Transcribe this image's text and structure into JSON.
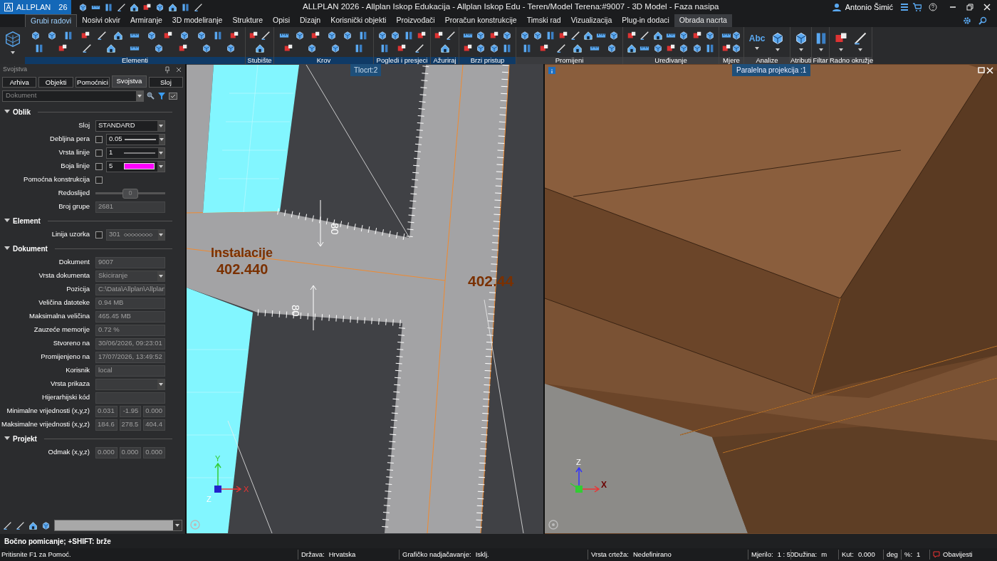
{
  "title_bar": {
    "logo": "ALLPLAN",
    "version": "26",
    "title": "ALLPLAN 2026 - Allplan Iskop Edukacija - Allplan Iskop Edu - Teren/Model Terena:#9007 - 3D Model - Faza nasipa",
    "user": "Antonio Šimić"
  },
  "ribbon": {
    "tabs": [
      {
        "label": "Grubi radovi",
        "selected": true,
        "contextual": false
      },
      {
        "label": "Nosivi okvir",
        "selected": false,
        "contextual": false
      },
      {
        "label": "Armiranje",
        "selected": false,
        "contextual": false
      },
      {
        "label": "3D modeliranje",
        "selected": false,
        "contextual": false
      },
      {
        "label": "Strukture",
        "selected": false,
        "contextual": false
      },
      {
        "label": "Opisi",
        "selected": false,
        "contextual": false
      },
      {
        "label": "Dizajn",
        "selected": false,
        "contextual": false
      },
      {
        "label": "Korisnički objekti",
        "selected": false,
        "contextual": false
      },
      {
        "label": "Proizvođači",
        "selected": false,
        "contextual": false
      },
      {
        "label": "Proračun konstrukcije",
        "selected": false,
        "contextual": false
      },
      {
        "label": "Timski rad",
        "selected": false,
        "contextual": false
      },
      {
        "label": "Vizualizacija",
        "selected": false,
        "contextual": false
      },
      {
        "label": "Plug-in dodaci",
        "selected": false,
        "contextual": false
      },
      {
        "label": "Obrada nacrta",
        "selected": false,
        "contextual": true
      }
    ],
    "groups": [
      {
        "label": "Elementi",
        "accent": true
      },
      {
        "label": "Stubište",
        "accent": true
      },
      {
        "label": "Krov",
        "accent": true
      },
      {
        "label": "Pogledi i presjeci",
        "accent": true
      },
      {
        "label": "Ažuriraj",
        "accent": true
      },
      {
        "label": "Brzi pristup",
        "accent": true
      },
      {
        "label": "Promijeni",
        "accent": false
      },
      {
        "label": "Uređivanje",
        "accent": false
      },
      {
        "label": "Mjere",
        "accent": false
      },
      {
        "label": "Analize",
        "accent": false,
        "icon_text": "Abc"
      },
      {
        "label": "Atributi",
        "accent": false
      },
      {
        "label": "Filtar",
        "accent": false
      },
      {
        "label": "Radno okružje",
        "accent": false
      }
    ]
  },
  "panel": {
    "title": "Svojstva",
    "tabs": [
      {
        "label": "Arhiva",
        "selected": false
      },
      {
        "label": "Objekti",
        "selected": false
      },
      {
        "label": "Pomoćnici",
        "selected": false
      },
      {
        "label": "Svojstva",
        "selected": true
      },
      {
        "label": "Sloj",
        "selected": false
      }
    ],
    "filter": {
      "value": "Dokument"
    },
    "sections": [
      {
        "title": "Oblik",
        "expanded": true,
        "rows": [
          {
            "kind": "dropdown",
            "label": "Sloj",
            "value": "STANDARD",
            "disabled": false
          },
          {
            "kind": "pen",
            "label": "Debljina pera",
            "checked": false,
            "value": "0.05"
          },
          {
            "kind": "line",
            "label": "Vrsta linije",
            "checked": false,
            "value": "1"
          },
          {
            "kind": "color",
            "label": "Boja linije",
            "checked": false,
            "value": "5",
            "color": "#ff00ff"
          },
          {
            "kind": "checkbox",
            "label": "Pomoćna konstrukcija",
            "checked": false
          },
          {
            "kind": "slider",
            "label": "Redoslijed",
            "value": "0",
            "level": 0.5
          },
          {
            "kind": "field",
            "label": "Broj grupe",
            "value": "2681",
            "disabled": true
          }
        ]
      },
      {
        "title": "Element",
        "expanded": true,
        "rows": [
          {
            "kind": "pattern",
            "label": "Linija uzorka",
            "checked": false,
            "value": "301"
          }
        ]
      },
      {
        "title": "Dokument",
        "expanded": true,
        "rows": [
          {
            "kind": "field",
            "label": "Dokument",
            "value": "9007",
            "disabled": true
          },
          {
            "kind": "dropdown",
            "label": "Vrsta dokumenta",
            "value": "Skiciranje",
            "disabled": true
          },
          {
            "kind": "field",
            "label": "Pozicija",
            "value": "C:\\Data\\Allplan\\Allplan",
            "disabled": true
          },
          {
            "kind": "field",
            "label": "Veličina datoteke",
            "value": "0.94 MB",
            "disabled": true
          },
          {
            "kind": "field",
            "label": "Maksimalna veličina",
            "value": "465.45 MB",
            "disabled": true
          },
          {
            "kind": "field",
            "label": "Zauzeće memorije",
            "value": "0.72 %",
            "disabled": true
          },
          {
            "kind": "field",
            "label": "Stvoreno na",
            "value": "30/06/2026, 09:23:01",
            "disabled": true
          },
          {
            "kind": "field",
            "label": "Promijenjeno na",
            "value": "17/07/2026, 13:49:52",
            "disabled": true
          },
          {
            "kind": "field",
            "label": "Korisnik",
            "value": "local",
            "disabled": true
          },
          {
            "kind": "dropdown",
            "label": "Vrsta prikaza",
            "disabled": true
          },
          {
            "kind": "field",
            "label": "Hijerarhijski kód",
            "disabled": true
          },
          {
            "kind": "triple",
            "label": "Minimalne vrijednosti (x,y,z)",
            "values": [
              "0.031",
              "-1.95",
              "0.000"
            ]
          },
          {
            "kind": "triple",
            "label": "Maksimalne vrijednosti (x,y,z)",
            "values": [
              "184.6",
              "278.5",
              "404.4"
            ]
          }
        ]
      },
      {
        "title": "Projekt",
        "expanded": true,
        "rows": [
          {
            "kind": "triple",
            "label": "Odmak (x,y,z)",
            "values": [
              "0.000",
              "0.000",
              "0.000"
            ]
          }
        ]
      }
    ]
  },
  "viewports": [
    {
      "kind": "plan",
      "label": "Tlocrt:2",
      "annotations": [
        "Instalacije",
        "402.440",
        "402.44",
        "80",
        "80"
      ],
      "axes": [
        "Y",
        "X",
        "Z"
      ]
    },
    {
      "kind": "model",
      "label": "Paralelna projekcija :1",
      "axes": [
        "Z",
        "X"
      ]
    }
  ],
  "command_line": "Bočno pomicanje; +SHIFT: brže",
  "status_bar": {
    "help": "Pritisnite F1 za Pomoć.",
    "items": [
      {
        "label": "Država:",
        "value": "Hrvatska"
      },
      {
        "label": "Grafičko nadjačavanje:",
        "value": "Isklj."
      },
      {
        "label": "Vrsta crteža:",
        "value": "Nedefinirano"
      },
      {
        "label": "Mjerilo:",
        "value": "1 : 50"
      },
      {
        "label": "Dužina:",
        "value": "m"
      },
      {
        "label": "Kut:",
        "value": "0.000"
      },
      {
        "label": "deg"
      },
      {
        "label": "%:",
        "value": "1"
      }
    ],
    "notifications": "Obavijesti"
  }
}
